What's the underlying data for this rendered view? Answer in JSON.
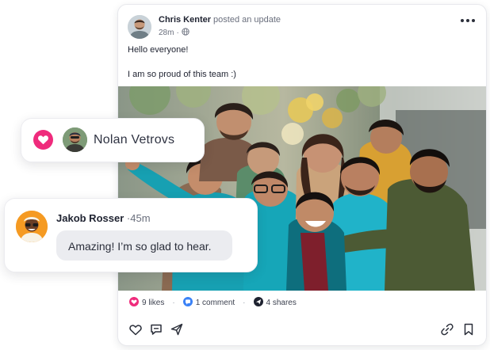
{
  "post": {
    "author": "Chris Kenter",
    "action": "posted an update",
    "time": "28m",
    "visibility_icon": "globe-icon",
    "menu_icon": "more-horizontal-icon",
    "lines": [
      "Hello everyone!",
      "I am so proud of this team :)"
    ],
    "stats": {
      "likes": "9 likes",
      "comments": "1 comment",
      "shares": "4 shares",
      "separator": "·"
    },
    "actions": [
      "heart-icon",
      "comment-icon",
      "share-icon",
      "link-icon",
      "bookmark-icon"
    ]
  },
  "reaction": {
    "name": "Nolan Vetrovs",
    "icon": "heart-icon"
  },
  "comment": {
    "author": "Jakob Rosser",
    "separator": "·",
    "time": "45m",
    "text": "Amazing! I’m so glad to hear."
  },
  "colors": {
    "accent_pink": "#ef2b7c",
    "accent_blue": "#3b82f6",
    "text_dark": "#1e2230",
    "text_muted": "#6a6f7d",
    "bubble": "#ebecf0"
  }
}
